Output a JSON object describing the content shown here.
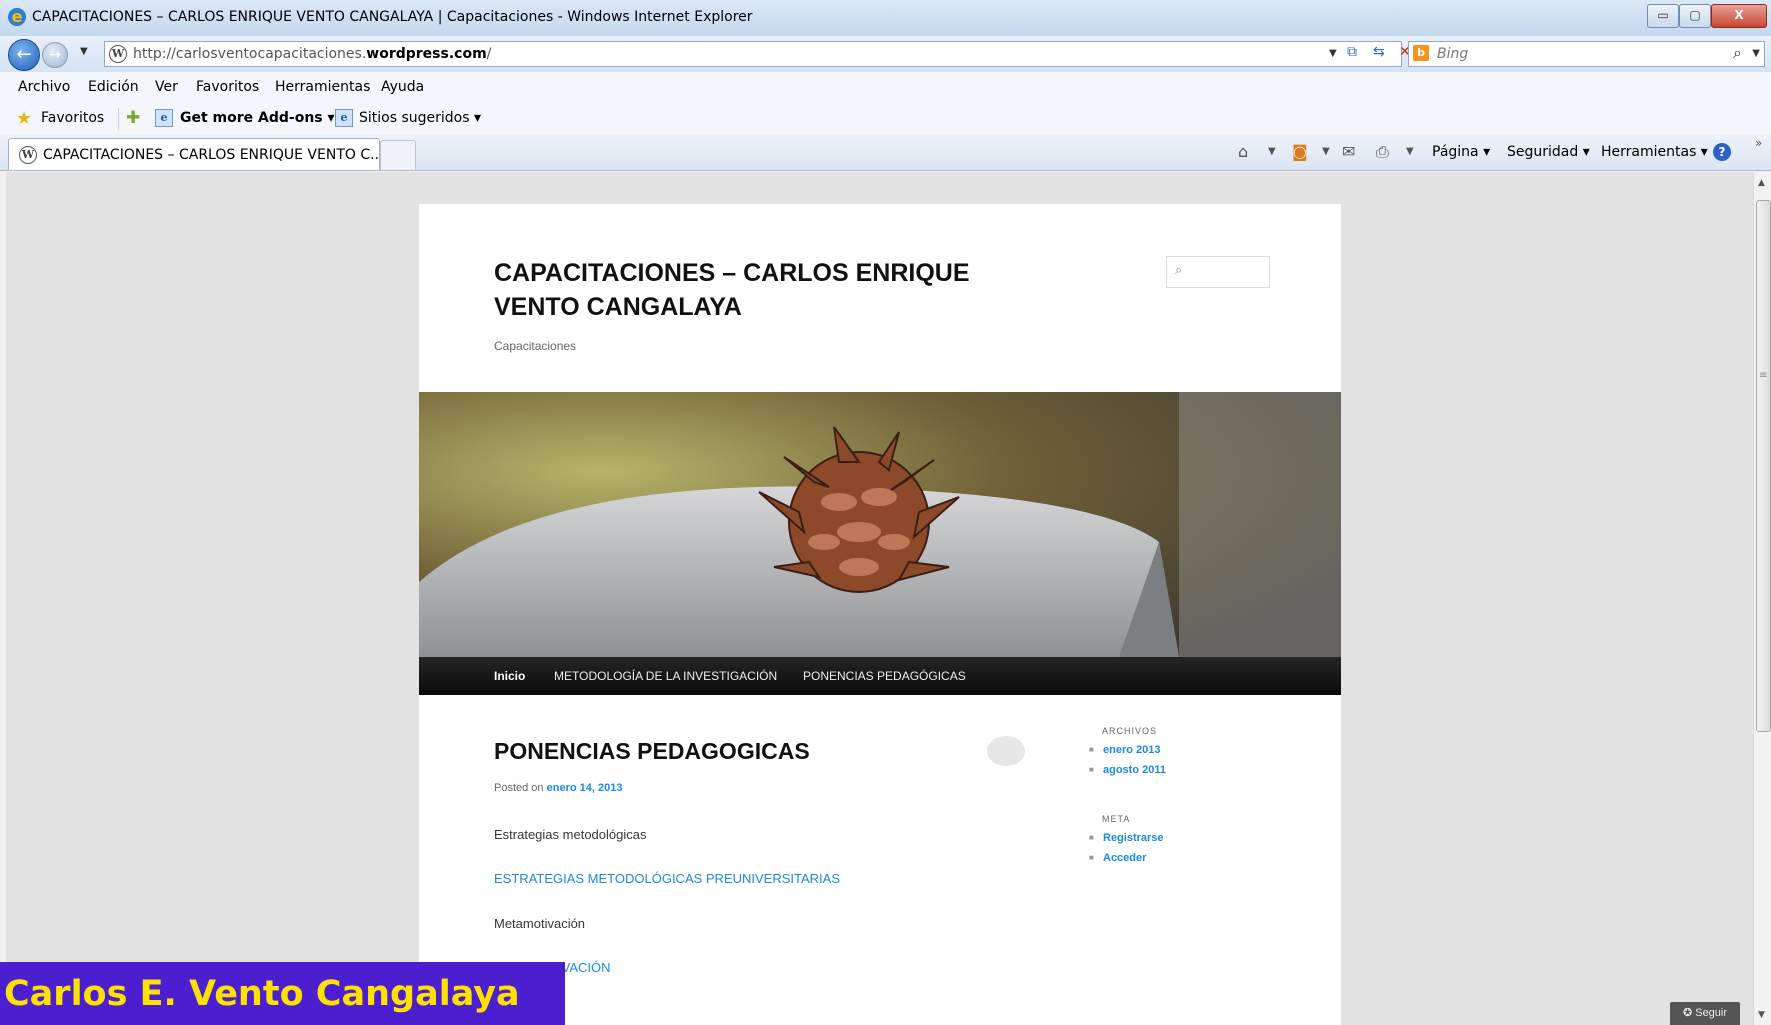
{
  "window": {
    "title": "CAPACITACIONES – CARLOS ENRIQUE VENTO CANGALAYA | Capacitaciones - Windows Internet Explorer",
    "min_glyph": "▭",
    "max_glyph": "▢",
    "close_glyph": "X"
  },
  "address_bar": {
    "url_prefix": "http://carlosventocapacitaciones.",
    "url_domain": "wordpress.com",
    "url_suffix": "/"
  },
  "search_bar": {
    "placeholder": "Bing"
  },
  "menu": [
    "Archivo",
    "Edición",
    "Ver",
    "Favoritos",
    "Herramientas",
    "Ayuda"
  ],
  "favorites_bar": {
    "favorites_label": "Favoritos",
    "addons_label": "Get more Add-ons ▾",
    "suggested_label": "Sitios sugeridos ▾"
  },
  "tab": {
    "title": "CAPACITACIONES – CARLOS ENRIQUE VENTO C..."
  },
  "command_bar": {
    "page_label": "Página ▾",
    "security_label": "Seguridad ▾",
    "tools_label": "Herramientas ▾"
  },
  "site": {
    "title_line1": "CAPACITACIONES – CARLOS ENRIQUE",
    "title_line2": "VENTO CANGALAYA",
    "description": "Capacitaciones",
    "nav": [
      "Inicio",
      "METODOLOGÍA DE LA INVESTIGACIÓN",
      "PONENCIAS PEDAGÓGICAS"
    ]
  },
  "post": {
    "title": "PONENCIAS PEDAGOGICAS",
    "posted_prefix": "Posted on",
    "posted_date": "enero 14, 2013",
    "p1": "Estrategias metodológicas",
    "link1": "ESTRATEGIAS METODOLÓGICAS PREUNIVERSITARIAS",
    "p2": "Metamotivación",
    "link2": "METAMOTIVACIÓN"
  },
  "sidebar": {
    "archives_title": "ARCHIVOS",
    "archives": [
      "enero 2013",
      "agosto 2011"
    ],
    "meta_title": "META",
    "meta": [
      "Registrarse",
      "Acceder"
    ]
  },
  "follow_button": "✪ Seguir",
  "caption": "Carlos E. Vento Cangalaya",
  "colors": {
    "link": "#1b8be0",
    "caption_bg": "#4b1fd0",
    "caption_text": "#ffe100",
    "nav_bg": "#111111"
  },
  "icons": [
    "ie-logo-icon",
    "back-icon",
    "forward-icon",
    "wordpress-icon",
    "refresh-icon",
    "stop-icon",
    "compat-icon",
    "bing-icon",
    "search-icon",
    "star-icon",
    "add-favorite-icon",
    "home-icon",
    "feeds-icon",
    "mail-icon",
    "print-icon",
    "help-icon",
    "comment-bubble-icon"
  ]
}
